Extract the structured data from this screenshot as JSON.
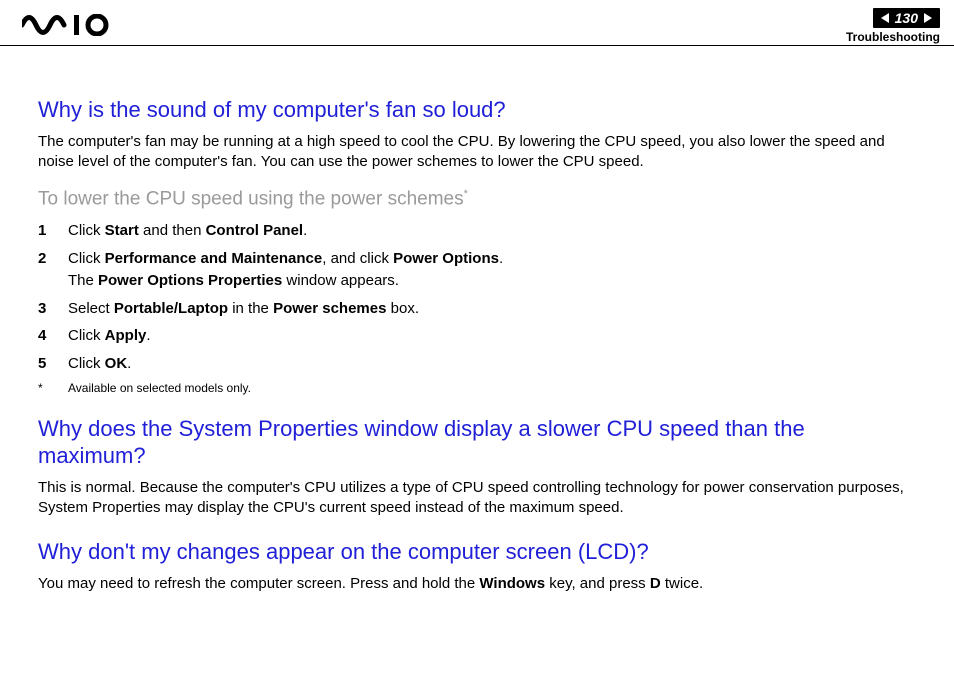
{
  "header": {
    "page_number": "130",
    "section": "Troubleshooting"
  },
  "q1": {
    "title": "Why is the sound of my computer's fan so loud?",
    "para": "The computer's fan may be running at a high speed to cool the CPU. By lowering the CPU speed, you also lower the speed and noise level of the computer's fan. You can use the power schemes to lower the CPU speed.",
    "subheading": "To lower the CPU speed using the power schemes",
    "subheading_mark": "*",
    "steps": {
      "s1_a": "Click ",
      "s1_b": "Start",
      "s1_c": " and then ",
      "s1_d": "Control Panel",
      "s1_e": ".",
      "s2_a": "Click ",
      "s2_b": "Performance and Maintenance",
      "s2_c": ", and click ",
      "s2_d": "Power Options",
      "s2_e": ".",
      "s2_sub_a": "The ",
      "s2_sub_b": "Power Options Properties",
      "s2_sub_c": " window appears.",
      "s3_a": "Select ",
      "s3_b": "Portable/Laptop",
      "s3_c": " in the ",
      "s3_d": "Power schemes",
      "s3_e": " box.",
      "s4_a": "Click ",
      "s4_b": "Apply",
      "s4_c": ".",
      "s5_a": "Click ",
      "s5_b": "OK",
      "s5_c": "."
    },
    "footnote_mark": "*",
    "footnote_text": "Available on selected models only."
  },
  "q2": {
    "title": "Why does the System Properties window display a slower CPU speed than the maximum?",
    "para": "This is normal. Because the computer's CPU utilizes a type of CPU speed controlling technology for power conservation purposes, System Properties may display the CPU's current speed instead of the maximum speed."
  },
  "q3": {
    "title": "Why don't my changes appear on the computer screen (LCD)?",
    "para_a": "You may need to refresh the computer screen. Press and hold the ",
    "para_b": "Windows",
    "para_c": " key, and press ",
    "para_d": "D",
    "para_e": " twice."
  }
}
